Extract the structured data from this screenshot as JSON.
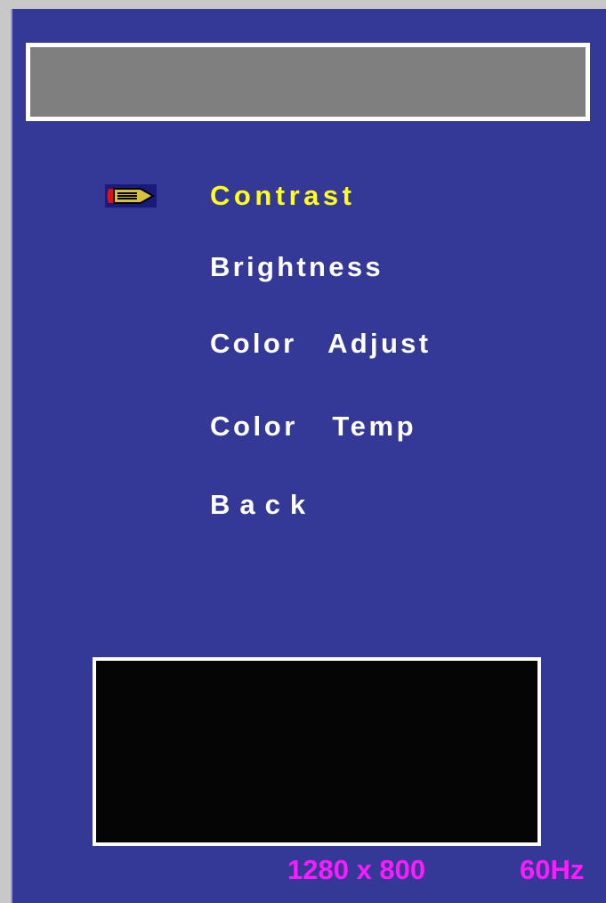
{
  "osd": {
    "title": "",
    "selector_icon": "pencil-pointer-icon",
    "menu": [
      {
        "label": "Contrast",
        "selected": true
      },
      {
        "label": "Brightness",
        "selected": false
      },
      {
        "label": "Color  Adjust",
        "selected": false
      },
      {
        "label": "Color  Temp",
        "selected": false
      },
      {
        "label": "Back",
        "selected": false
      }
    ],
    "status": {
      "resolution": "1280 x 800",
      "refresh_rate": "60Hz"
    },
    "colors": {
      "background": "#343896",
      "selected_text": "#ffff1a",
      "menu_text": "#ffffff",
      "status_text": "#ff1aff",
      "title_bar": "#7f7f7f",
      "preview_box": "#050505"
    }
  }
}
